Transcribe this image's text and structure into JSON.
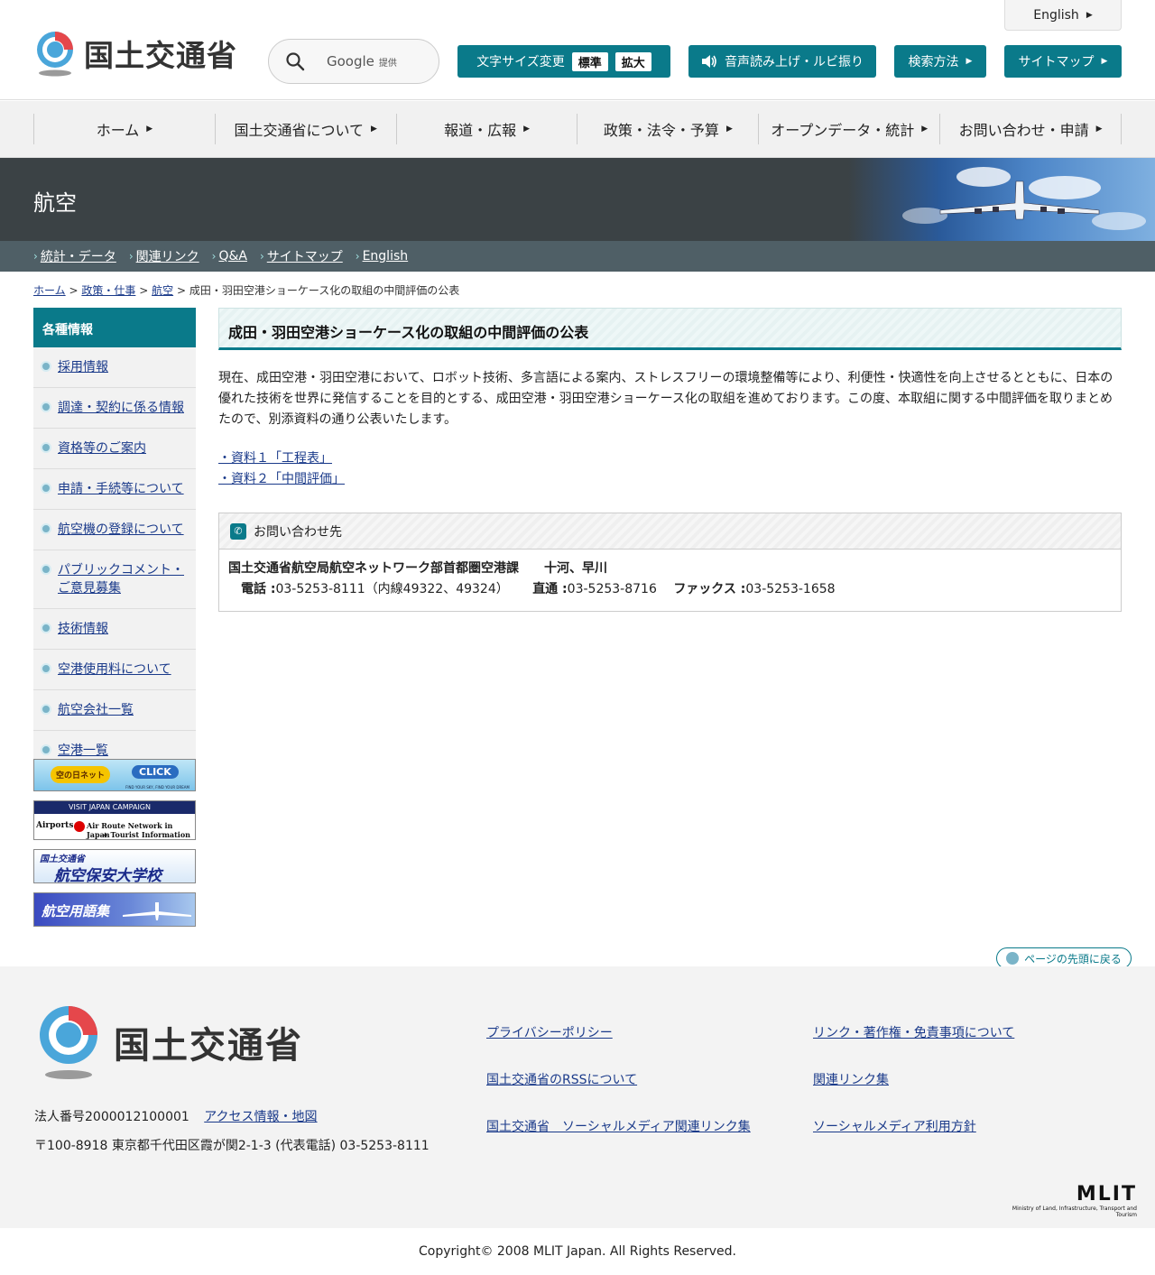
{
  "header": {
    "logo_text": "国土交通省",
    "search": {
      "provider": "Google",
      "provider_suffix": "提供"
    },
    "english_label": "English",
    "font_size_label": "文字サイズ変更",
    "font_size_normal": "標準",
    "font_size_large": "拡大",
    "voice_label": "音声読み上げ・ルビ振り",
    "search_method_label": "検索方法",
    "sitemap_label": "サイトマップ"
  },
  "gnav": [
    "ホーム",
    "国土交通省について",
    "報道・広報",
    "政策・法令・予算",
    "オープンデータ・統計",
    "お問い合わせ・申請"
  ],
  "banner": {
    "title": "航空"
  },
  "subnav": [
    "統計・データ",
    "関連リンク",
    "Q&A",
    "サイトマップ",
    "English"
  ],
  "breadcrumb": {
    "items": [
      "ホーム",
      "政策・仕事",
      "航空"
    ],
    "current": "成田・羽田空港ショーケース化の取組の中間評価の公表",
    "sep": ">"
  },
  "sidebar": {
    "heading": "各種情報",
    "items": [
      "採用情報",
      "調達・契約に係る情報",
      "資格等のご案内",
      "申請・手続等について",
      "航空機の登録について",
      "パブリックコメント・ご意見募集",
      "技術情報",
      "空港使用料について",
      "航空会社一覧",
      "空港一覧"
    ],
    "banners": {
      "sora_no_hi": {
        "logo": "空の日ネット",
        "click": "CLICK",
        "tagline": "FIND YOUR SKY, FIND YOUR DREAM"
      },
      "visit_japan": {
        "top": "VISIT JAPAN CAMPAIGN",
        "line1": "Airports",
        "line2": "Air Route Network in Japan",
        "line3": "+ Tourist Information"
      },
      "academy": {
        "top": "国土交通省",
        "main": "航空保安大学校"
      },
      "glossary": {
        "main": "航空用語集"
      }
    }
  },
  "main": {
    "title": "成田・羽田空港ショーケース化の取組の中間評価の公表",
    "body": "現在、成田空港・羽田空港において、ロボット技術、多言語による案内、ストレスフリーの環境整備等により、利便性・快適性を向上させるとともに、日本の優れた技術を世界に発信することを目的とする、成田空港・羽田空港ショーケース化の取組を進めております。この度、本取組に関する中間評価を取りまとめたので、別添資料の通り公表いたします。",
    "links": [
      "・資料１「工程表」",
      "・資料２「中間評価」"
    ],
    "contact": {
      "heading": "お問い合わせ先",
      "dept": "国土交通省航空局航空ネットワーク部首都圏空港課　　十河、早川",
      "tel_label": "電話 :",
      "tel": "03-5253-8111（内線49322、49324）",
      "direct_label": "直通 :",
      "direct": "03-5253-8716",
      "fax_label": "ファックス :",
      "fax": "03-5253-1658"
    }
  },
  "to_top": "ページの先頭に戻る",
  "footer": {
    "logo_text": "国土交通省",
    "corp_number": "法人番号2000012100001",
    "access": "アクセス情報・地図",
    "address": "〒100-8918 東京都千代田区霞が関2-1-3 (代表電話) 03-5253-8111",
    "links": [
      "プライバシーポリシー",
      "リンク・著作権・免責事項について",
      "国土交通省のRSSについて",
      "関連リンク集",
      "国土交通省　ソーシャルメディア関連リンク集",
      "ソーシャルメディア利用方針"
    ],
    "mlit": "MLIT",
    "mlit_full": "Ministry of Land, Infrastructure, Transport and Tourism",
    "copyright": "Copyright© 2008 MLIT Japan. All Rights Reserved."
  },
  "colors": {
    "accent": "#0a7a8a",
    "link": "#1a3a8a",
    "banner_bg": "#3b4245",
    "subnav_bg": "#4f5f66"
  }
}
